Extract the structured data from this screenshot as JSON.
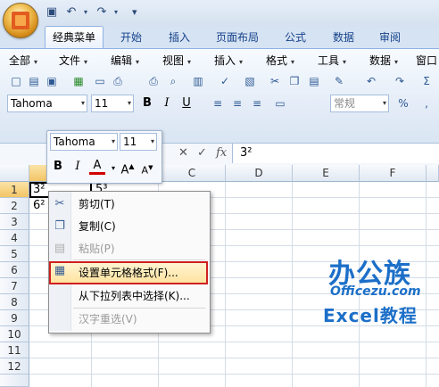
{
  "tabs": [
    "经典菜单",
    "开始",
    "插入",
    "页面布局",
    "公式",
    "数据",
    "审阅"
  ],
  "active_tab": "经典菜单",
  "menubar": [
    {
      "label": "全部"
    },
    {
      "label": "文件"
    },
    {
      "label": "编辑"
    },
    {
      "label": "视图"
    },
    {
      "label": "插入"
    },
    {
      "label": "格式"
    },
    {
      "label": "工具"
    },
    {
      "label": "数据"
    },
    {
      "label": "窗口"
    }
  ],
  "font": {
    "name": "Tahoma",
    "size": "11"
  },
  "number_format": "常规",
  "formula_bar": {
    "value": "3²"
  },
  "columns": [
    "A",
    "B",
    "C",
    "D",
    "E",
    "F"
  ],
  "rows": [
    "1",
    "2",
    "3",
    "4",
    "5",
    "6",
    "7",
    "8",
    "9",
    "10",
    "11",
    "12"
  ],
  "cells": {
    "A1": "3²",
    "B1": "5³",
    "A2": "6²"
  },
  "mini_toolbar": {
    "font": "Tahoma",
    "size": "11"
  },
  "context_menu": [
    {
      "label": "剪切(T)",
      "icon": "scissors-icon",
      "enabled": true
    },
    {
      "label": "复制(C)",
      "icon": "copy-icon",
      "enabled": true
    },
    {
      "label": "粘贴(P)",
      "icon": "paste-icon",
      "enabled": false
    },
    {
      "label": "设置单元格格式(F)...",
      "icon": "format-cells-icon",
      "enabled": true,
      "highlighted": true
    },
    {
      "label": "从下拉列表中选择(K)...",
      "icon": "",
      "enabled": true
    },
    {
      "label": "汉字重选(V)",
      "icon": "",
      "enabled": false
    }
  ],
  "watermark": {
    "logo": "办公族",
    "domain": "Officezu.com",
    "subtitle": "Excel教程"
  },
  "colors": {
    "accent": "#15428b",
    "highlight_border": "#d02020",
    "watermark": "#1c6fc8"
  }
}
